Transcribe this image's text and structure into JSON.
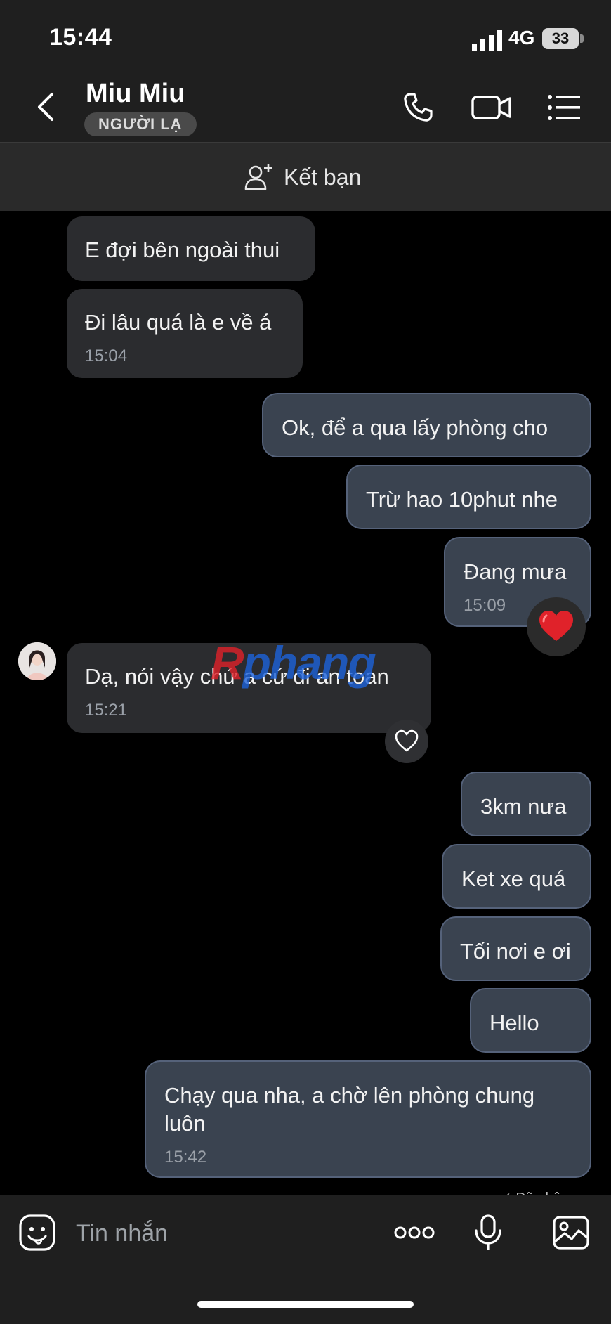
{
  "status_bar": {
    "time": "15:44",
    "network": "4G",
    "battery": "33"
  },
  "header": {
    "contact_name": "Miu Miu",
    "badge": "NGƯỜI LẠ"
  },
  "friend_bar": {
    "label": "Kết bạn"
  },
  "messages": [
    {
      "side": "in",
      "text": "E đợi bên ngoài thui",
      "time": ""
    },
    {
      "side": "in",
      "text": "Đi lâu quá là e về á",
      "time": "15:04"
    },
    {
      "side": "out",
      "text": "Ok, để a qua lấy phòng cho",
      "time": ""
    },
    {
      "side": "out",
      "text": "Trừ hao 10phut nhe",
      "time": ""
    },
    {
      "side": "out",
      "text": "Đang mưa",
      "time": "15:09",
      "reaction": "heart-filled"
    },
    {
      "side": "in",
      "text": "Dạ, nói vậy chứ a cứ đi an toan",
      "time": "15:21",
      "reaction": "heart-outline"
    },
    {
      "side": "out",
      "text": "3km nưa",
      "time": ""
    },
    {
      "side": "out",
      "text": "Ket xe quá",
      "time": ""
    },
    {
      "side": "out",
      "text": "Tối nơi e ơi",
      "time": ""
    },
    {
      "side": "out",
      "text": "Hello",
      "time": ""
    },
    {
      "side": "out",
      "text": "Chạy qua nha, a chờ lên phòng chung luôn",
      "time": "15:42"
    }
  ],
  "watermark": {
    "part1": "R",
    "part2": "phang"
  },
  "partial_status": "✓ Đã nhận",
  "composer": {
    "placeholder": "Tin nhắn"
  },
  "colors": {
    "incoming_bubble": "#2b2c2f",
    "outgoing_bubble": "#3a4350",
    "reaction_heart": "#e0222a"
  }
}
